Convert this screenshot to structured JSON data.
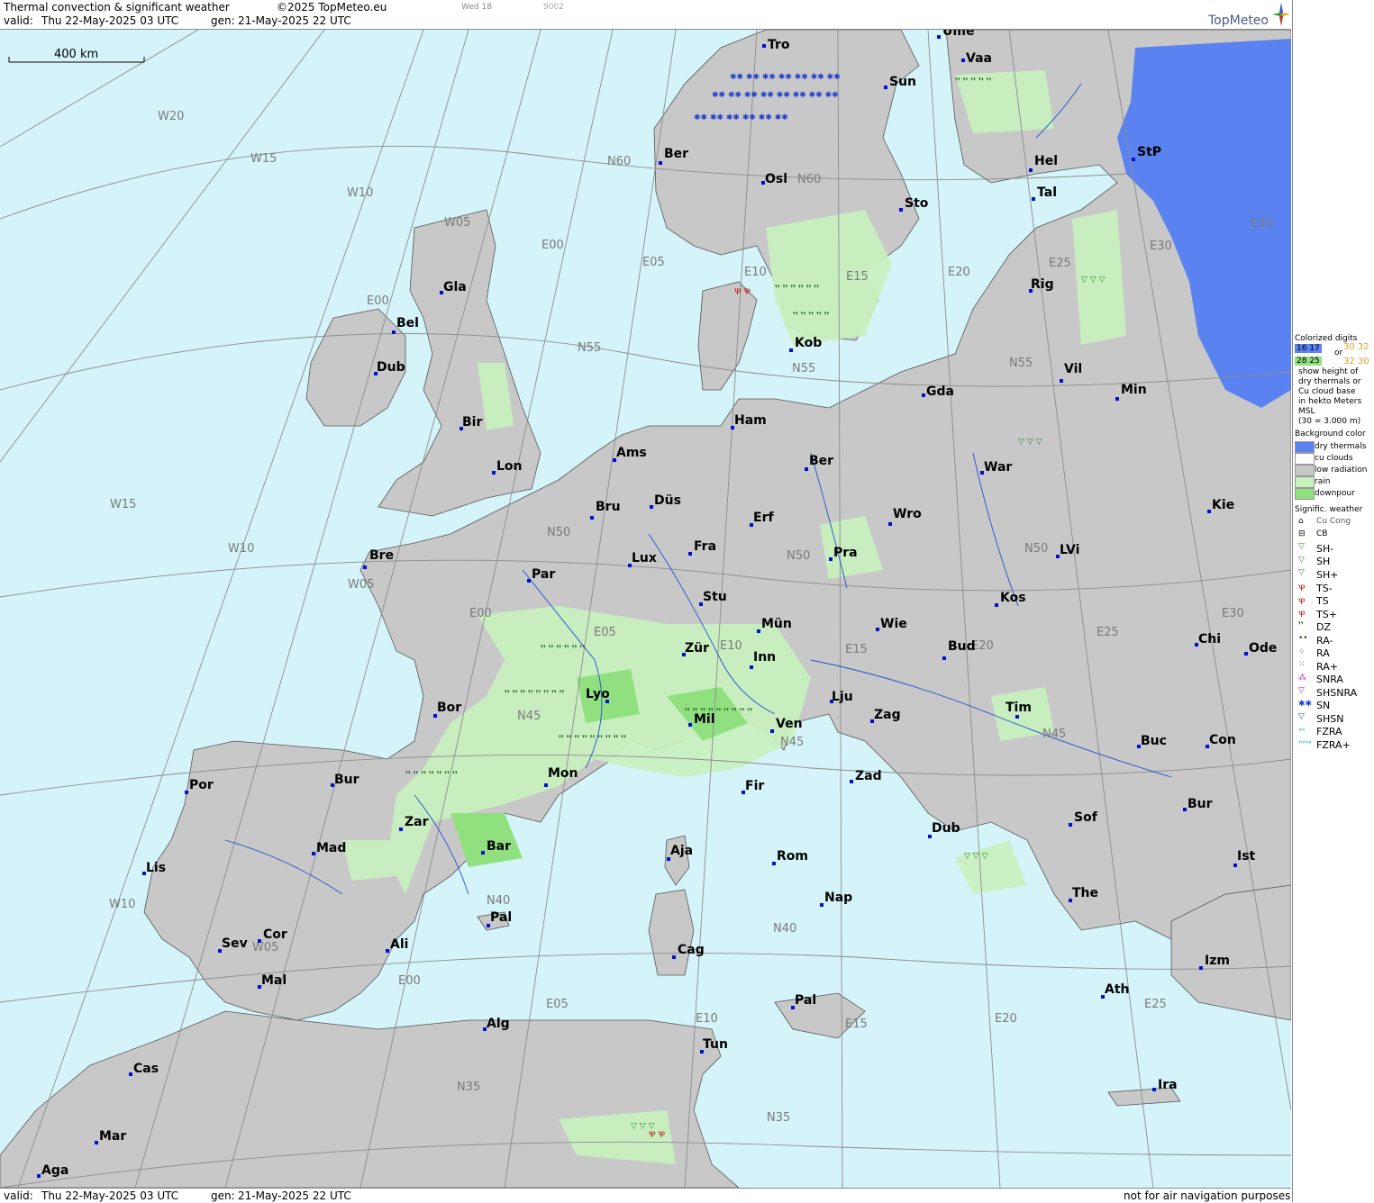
{
  "header": {
    "title": "Thermal convection & significant weather",
    "copyright": "©2025 TopMeteo.eu",
    "day_label": "Wed 18",
    "code": "9002",
    "valid_label": "valid:",
    "valid_value": "Thu  22-May-2025  03 UTC",
    "gen_label": "gen:",
    "gen_value": "21-May-2025 22 UTC",
    "brand": "TopMeteo"
  },
  "scale_bar": {
    "label": "400 km"
  },
  "footer": {
    "valid_label": "valid:",
    "valid_value": "Thu  22-May-2025  03 UTC",
    "gen_label": "gen:",
    "gen_value": "21-May-2025 22 UTC",
    "disclaimer": "not for air navigation purposes"
  },
  "colors": {
    "sea": "#d4f4fa",
    "land": "#c8c8c8",
    "rain": "#c8f0c0",
    "downpour": "#90e080",
    "dry_thermals": "#5a82f0",
    "grid": "#8c8c8c",
    "rivers": "#1e50d0"
  },
  "cities": [
    {
      "name": "Tro"
    },
    {
      "name": "Ume"
    },
    {
      "name": "Vaa"
    },
    {
      "name": "Sun"
    },
    {
      "name": "Ber"
    },
    {
      "name": "Osl"
    },
    {
      "name": "Hel"
    },
    {
      "name": "StP"
    },
    {
      "name": "Sto"
    },
    {
      "name": "Tal"
    },
    {
      "name": "Gla"
    },
    {
      "name": "Rig"
    },
    {
      "name": "Bel"
    },
    {
      "name": "Kob"
    },
    {
      "name": "Dub"
    },
    {
      "name": "Gda"
    },
    {
      "name": "Vil"
    },
    {
      "name": "Min"
    },
    {
      "name": "Ham"
    },
    {
      "name": "Bir"
    },
    {
      "name": "Ams"
    },
    {
      "name": "Ber"
    },
    {
      "name": "Lon"
    },
    {
      "name": "War"
    },
    {
      "name": "Düs"
    },
    {
      "name": "Bru"
    },
    {
      "name": "Kie"
    },
    {
      "name": "Erf"
    },
    {
      "name": "Wro"
    },
    {
      "name": "Bre"
    },
    {
      "name": "Fra"
    },
    {
      "name": "Pra"
    },
    {
      "name": "Lux"
    },
    {
      "name": "LVi"
    },
    {
      "name": "Par"
    },
    {
      "name": "Stu"
    },
    {
      "name": "Kos"
    },
    {
      "name": "Mün"
    },
    {
      "name": "Wie"
    },
    {
      "name": "Chi"
    },
    {
      "name": "Zür"
    },
    {
      "name": "Bud"
    },
    {
      "name": "Ode"
    },
    {
      "name": "Inn"
    },
    {
      "name": "Lyo"
    },
    {
      "name": "Lju"
    },
    {
      "name": "Tim"
    },
    {
      "name": "Bor"
    },
    {
      "name": "Mil"
    },
    {
      "name": "Zag"
    },
    {
      "name": "Ven"
    },
    {
      "name": "Buc"
    },
    {
      "name": "Con"
    },
    {
      "name": "Bur"
    },
    {
      "name": "Mon"
    },
    {
      "name": "Zad"
    },
    {
      "name": "Por"
    },
    {
      "name": "Fir"
    },
    {
      "name": "Bur"
    },
    {
      "name": "Zar"
    },
    {
      "name": "Sof"
    },
    {
      "name": "Dub"
    },
    {
      "name": "Mad"
    },
    {
      "name": "Bar"
    },
    {
      "name": "Aja"
    },
    {
      "name": "Ist"
    },
    {
      "name": "Rom"
    },
    {
      "name": "Lis"
    },
    {
      "name": "The"
    },
    {
      "name": "Nap"
    },
    {
      "name": "Pal"
    },
    {
      "name": "Cor"
    },
    {
      "name": "Sev"
    },
    {
      "name": "Ali"
    },
    {
      "name": "Cag"
    },
    {
      "name": "Izm"
    },
    {
      "name": "Mal"
    },
    {
      "name": "Ath"
    },
    {
      "name": "Pal"
    },
    {
      "name": "Alg"
    },
    {
      "name": "Tun"
    },
    {
      "name": "Cas"
    },
    {
      "name": "Ira"
    },
    {
      "name": "Mar"
    },
    {
      "name": "Aga"
    }
  ],
  "grid_labels": [
    "W20",
    "W15",
    "W10",
    "W05",
    "E00",
    "E05",
    "E10",
    "E15",
    "E20",
    "E25",
    "E30",
    "E35",
    "N60",
    "N55",
    "N50",
    "N45",
    "N40",
    "N35",
    "N45",
    "N40",
    "N35",
    "N50",
    "N55",
    "N60",
    "W15",
    "W10",
    "W05",
    "E00",
    "W10",
    "W05",
    "E00",
    "E05",
    "E10",
    "E15",
    "E20",
    "E25",
    "E30",
    "E25",
    "E20",
    "E15",
    "E10",
    "E05",
    "E00",
    "N55",
    "N50",
    "N45"
  ],
  "legend": {
    "colorized_title": "Colorized digits",
    "sample_a": "16 17",
    "sample_b": "28 25",
    "or_word": "or",
    "sample_c": "30 32",
    "sample_d": "32 30",
    "colorized_desc": [
      "show height of",
      "dry thermals or",
      "Cu cloud base",
      "in hekto Meters",
      "MSL",
      "(30 = 3.000 m)"
    ],
    "bg_title": "Background color",
    "bg_items": [
      {
        "label": "dry thermals",
        "color": "#5a82f0"
      },
      {
        "label": "cu clouds",
        "color": "#ffffff"
      },
      {
        "label": "low radiation",
        "color": "#c8c8c8"
      },
      {
        "label": "rain",
        "color": "#c8f0c0"
      },
      {
        "label": "downpour",
        "color": "#90e080"
      }
    ],
    "wx_title": "Signific. weather",
    "wx_items": [
      {
        "symbol": "⌂",
        "label": "Cu Cong",
        "color": "#000"
      },
      {
        "symbol": "⊟",
        "label": "CB",
        "color": "#000"
      },
      {
        "symbol": "▽",
        "label": "SH-",
        "color": "#2a8a2a"
      },
      {
        "symbol": "▽",
        "label": "SH",
        "color": "#2a8a2a"
      },
      {
        "symbol": "▽",
        "label": "SH+",
        "color": "#2a8a2a"
      },
      {
        "symbol": "Ꝕ",
        "label": "TS-",
        "color": "#c00000"
      },
      {
        "symbol": "Ꝕ",
        "label": "TS",
        "color": "#c00000"
      },
      {
        "symbol": "Ꝕ",
        "label": "TS+",
        "color": "#c00000"
      },
      {
        "symbol": "❜❜",
        "label": "DZ",
        "color": "#1a5a1a"
      },
      {
        "symbol": "••",
        "label": "RA-",
        "color": "#1a5a1a"
      },
      {
        "symbol": "⁘",
        "label": "RA",
        "color": "#1a5a1a"
      },
      {
        "symbol": "⁙",
        "label": "RA+",
        "color": "#1a5a1a"
      },
      {
        "symbol": "⁂",
        "label": "SNRA",
        "color": "#c020c0"
      },
      {
        "symbol": "▽",
        "label": "SHSNRA",
        "color": "#c020c0"
      },
      {
        "symbol": "✱✱",
        "label": "SN",
        "color": "#2040d0"
      },
      {
        "symbol": "▽",
        "label": "SHSN",
        "color": "#2040d0"
      },
      {
        "symbol": "∾",
        "label": "FZRA",
        "color": "#20c0c0"
      },
      {
        "symbol": "∾∾",
        "label": "FZRA+",
        "color": "#20c0c0"
      }
    ]
  }
}
